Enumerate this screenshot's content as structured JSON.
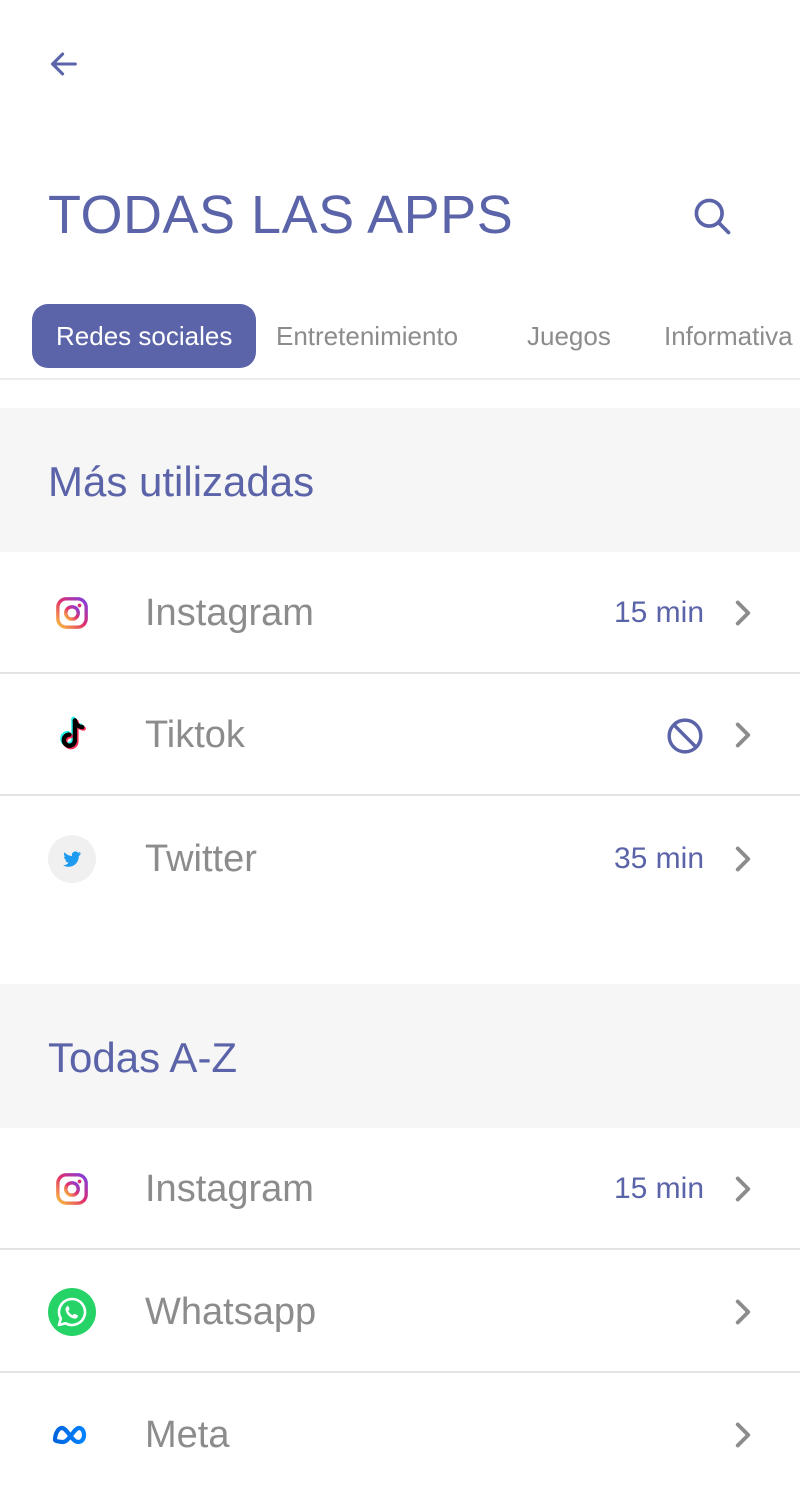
{
  "header": {
    "back_icon": "arrow-left-icon",
    "title": "TODAS LAS APPS",
    "search_icon": "search-icon"
  },
  "tabs": [
    {
      "label": "Redes sociales",
      "active": true
    },
    {
      "label": "Entretenimiento",
      "active": false
    },
    {
      "label": "Juegos",
      "active": false
    },
    {
      "label": "Informativa",
      "active": false
    }
  ],
  "sections": [
    {
      "title": "Más utilizadas",
      "apps": [
        {
          "name": "Instagram",
          "icon": "instagram-icon",
          "usage": "15 min"
        },
        {
          "name": "Tiktok",
          "icon": "tiktok-icon",
          "status": "blocked-icon"
        },
        {
          "name": "Twitter",
          "icon": "twitter-icon",
          "usage": "35 min"
        }
      ]
    },
    {
      "title": "Todas A-Z",
      "apps": [
        {
          "name": "Instagram",
          "icon": "instagram-icon",
          "usage": "15 min"
        },
        {
          "name": "Whatsapp",
          "icon": "whatsapp-icon"
        },
        {
          "name": "Meta",
          "icon": "meta-icon"
        }
      ]
    }
  ],
  "colors": {
    "accent": "#5b64a8",
    "text_muted": "#8c8c8c",
    "section_bg": "#f6f6f6"
  }
}
